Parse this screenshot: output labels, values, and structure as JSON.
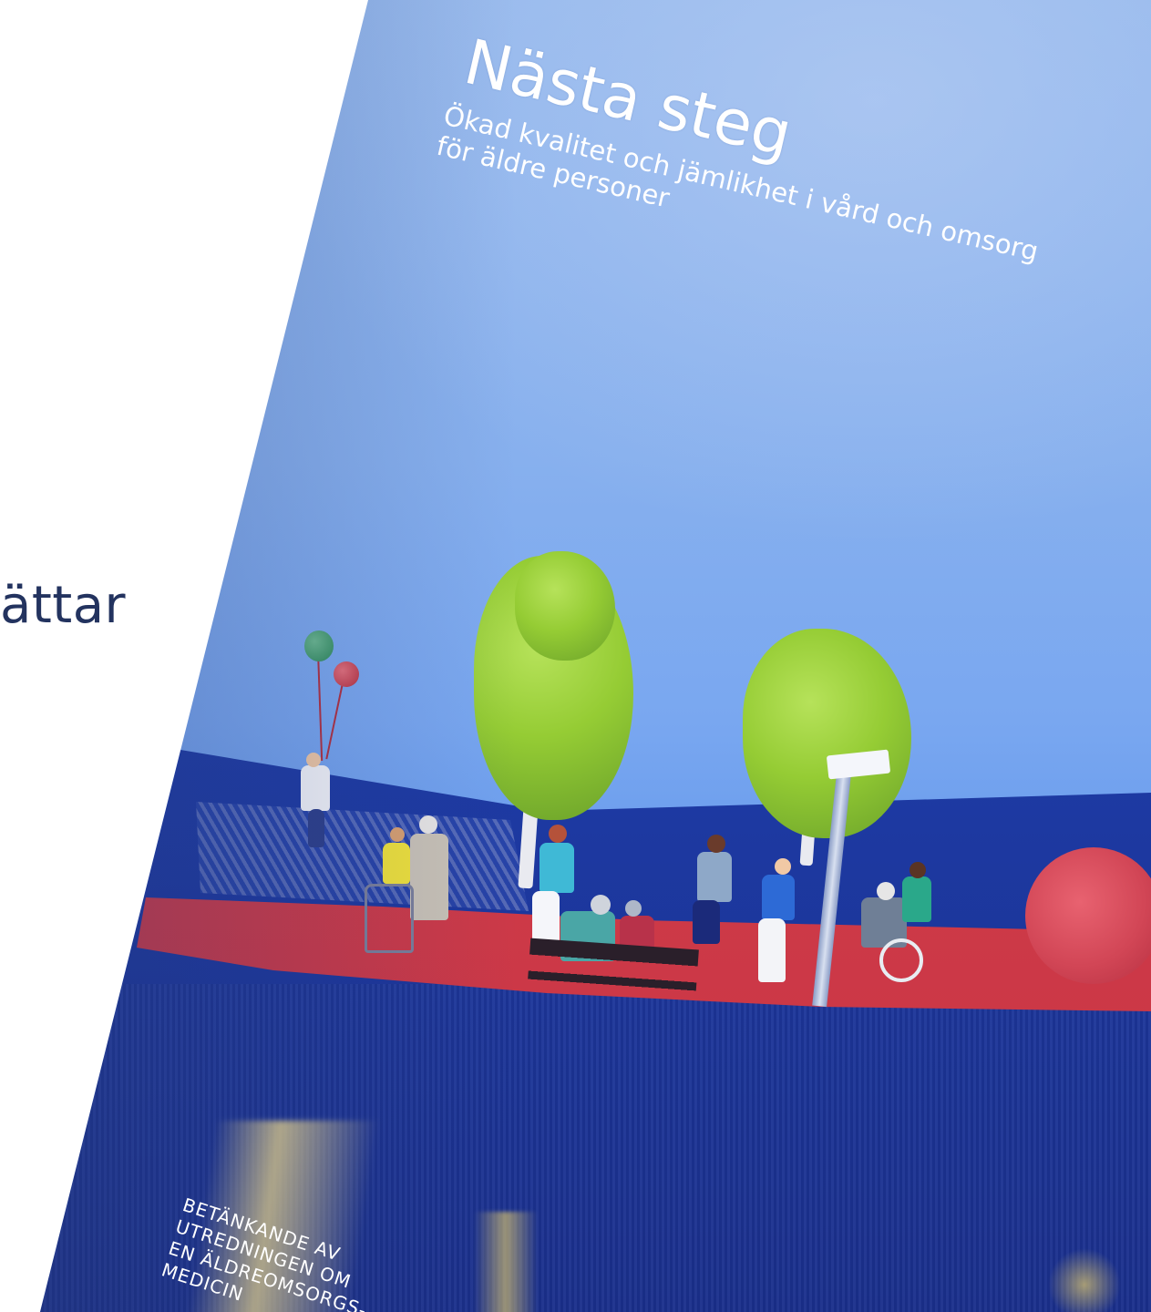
{
  "slide": {
    "fragment_text": "ättar"
  },
  "cover": {
    "title": "Nästa steg",
    "subtitle": "Ökad kvalitet och jämlikhet i vård och omsorg\nför äldre personer",
    "publisher": "BETÄNKANDE AV\nUTREDNINGEN OM\nEN ÄLDREOMSORGS-\nMEDICIN"
  },
  "colors": {
    "slide_text": "#23335f",
    "sky": "#87b0ee",
    "fabric_blue": "#1f3fae",
    "carpet_red": "#d24656",
    "tree_green": "#95cc34"
  }
}
